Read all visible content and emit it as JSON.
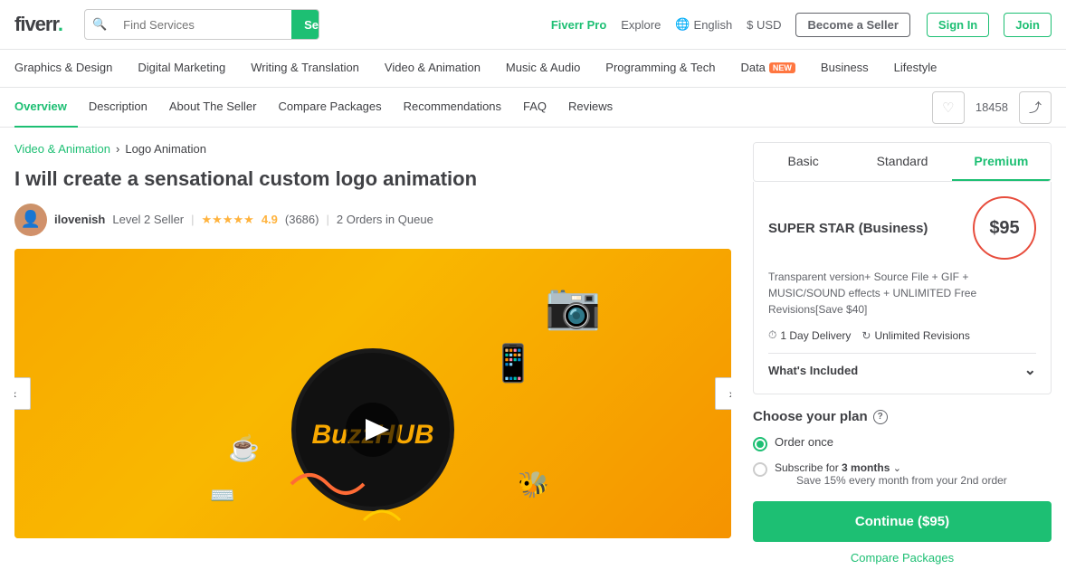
{
  "logo": {
    "text": "fiverr",
    "dot": "."
  },
  "search": {
    "placeholder": "Find Services",
    "button": "Search"
  },
  "topnav": {
    "pro": "Fiverr Pro",
    "explore": "Explore",
    "language": "English",
    "currency": "$ USD",
    "become_seller": "Become a Seller",
    "sign_in": "Sign In",
    "join": "Join"
  },
  "categories": [
    {
      "label": "Graphics & Design"
    },
    {
      "label": "Digital Marketing"
    },
    {
      "label": "Writing & Translation"
    },
    {
      "label": "Video & Animation"
    },
    {
      "label": "Music & Audio"
    },
    {
      "label": "Programming & Tech"
    },
    {
      "label": "Data",
      "badge": "NEW"
    },
    {
      "label": "Business"
    },
    {
      "label": "Lifestyle"
    }
  ],
  "subnav": {
    "items": [
      {
        "label": "Overview"
      },
      {
        "label": "Description"
      },
      {
        "label": "About The Seller"
      },
      {
        "label": "Compare Packages"
      },
      {
        "label": "Recommendations"
      },
      {
        "label": "FAQ"
      },
      {
        "label": "Reviews"
      }
    ],
    "likes_count": "18458"
  },
  "breadcrumb": {
    "parent": "Video & Animation",
    "child": "Logo Animation"
  },
  "gig": {
    "title": "I will create a sensational custom logo animation",
    "seller_name": "ilovenish",
    "seller_level": "Level 2 Seller",
    "rating": "4.9",
    "review_count": "(3686)",
    "queue": "2 Orders in Queue"
  },
  "package": {
    "tabs": [
      "Basic",
      "Standard",
      "Premium"
    ],
    "active_tab": "Premium",
    "name": "SUPER STAR (Business)",
    "price": "$95",
    "description": "Transparent version+ Source File + GIF + MUSIC/SOUND effects + UNLIMITED Free Revisions[Save $40]",
    "delivery": "1 Day Delivery",
    "revisions": "Unlimited Revisions",
    "whats_included": "What's Included"
  },
  "plan": {
    "title": "Choose your plan",
    "option1": "Order once",
    "option2_prefix": "Subscribe for",
    "option2_months": "3 months",
    "option2_detail": "Save 15% every month from your 2nd order"
  },
  "cta": {
    "continue": "Continue ($95)",
    "compare": "Compare Packages"
  }
}
